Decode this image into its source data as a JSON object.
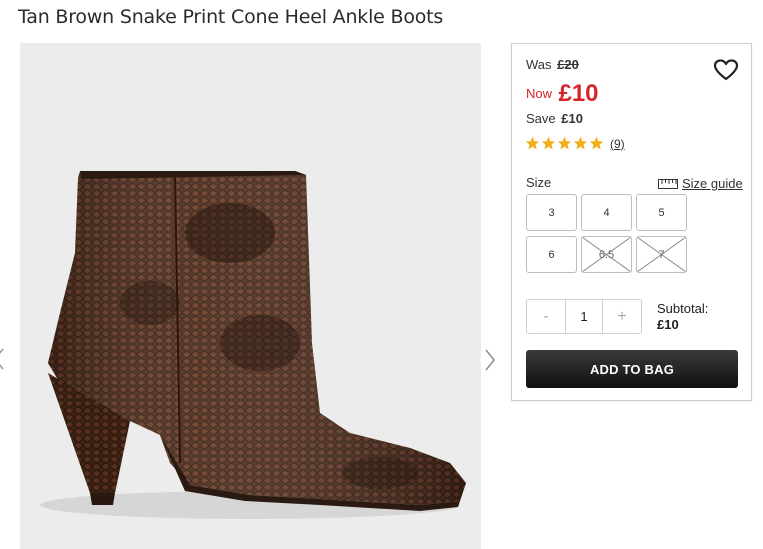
{
  "product": {
    "title": "Tan Brown Snake Print Cone Heel Ankle Boots"
  },
  "pricing": {
    "was_label": "Was",
    "was_price": "£20",
    "now_label": "Now",
    "now_price": "£10",
    "save_label": "Save",
    "save_amount": "£10"
  },
  "rating": {
    "stars": 5,
    "max_stars": 5,
    "reviews": "(9)",
    "star_color": "#f2b01e"
  },
  "size": {
    "label": "Size",
    "guide_label": "Size guide",
    "options": [
      {
        "label": "3",
        "available": true
      },
      {
        "label": "4",
        "available": true
      },
      {
        "label": "5",
        "available": true
      },
      {
        "label": "6",
        "available": true
      },
      {
        "label": "6.5",
        "available": false
      },
      {
        "label": "7",
        "available": false
      }
    ]
  },
  "quantity": {
    "minus": "-",
    "value": "1",
    "plus": "+"
  },
  "subtotal": {
    "label": "Subtotal:",
    "amount": "£10"
  },
  "cta": {
    "add_to_bag": "ADD TO BAG"
  },
  "colors": {
    "sale_red": "#d6262b",
    "button_dark": "#1a1a1a"
  },
  "icons": {
    "wishlist": "heart-icon",
    "size_guide": "ruler-icon",
    "prev": "chevron-left-icon",
    "next": "chevron-right-icon"
  }
}
